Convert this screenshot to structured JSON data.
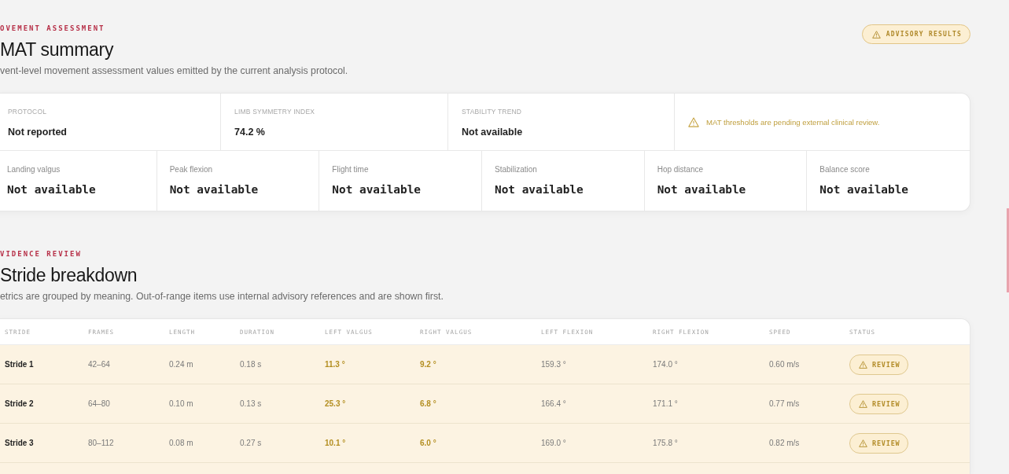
{
  "summary_section": {
    "eyebrow": "OVEMENT ASSESSMENT",
    "title": "MAT summary",
    "description": "vent-level movement assessment values emitted by the current analysis protocol.",
    "badge": {
      "label": "ADVISORY RESULTS",
      "kind": "advisory"
    },
    "overview": [
      {
        "label": "PROTOCOL",
        "value": "Not reported"
      },
      {
        "label": "LIMB SYMMETRY INDEX",
        "value": "74.2 %"
      },
      {
        "label": "STABILITY TREND",
        "value": "Not available"
      }
    ],
    "notice": "MAT thresholds are pending external clinical review.",
    "metrics": [
      {
        "label": "Landing valgus",
        "value": "Not available"
      },
      {
        "label": "Peak flexion",
        "value": "Not available"
      },
      {
        "label": "Flight time",
        "value": "Not available"
      },
      {
        "label": "Stabilization",
        "value": "Not available"
      },
      {
        "label": "Hop distance",
        "value": "Not available"
      },
      {
        "label": "Balance score",
        "value": "Not available"
      }
    ]
  },
  "evidence_section": {
    "eyebrow": "VIDENCE REVIEW",
    "title": "Stride breakdown",
    "description": "etrics are grouped by meaning. Out-of-range items use internal advisory references and are shown first.",
    "table": {
      "columns": [
        "STRIDE",
        "FRAMES",
        "LENGTH",
        "DURATION",
        "LEFT VALGUS",
        "RIGHT VALGUS",
        "LEFT FLEXION",
        "RIGHT FLEXION",
        "SPEED",
        "STATUS"
      ],
      "rows": [
        {
          "flagged": true,
          "cells": [
            {
              "text": "Stride 1",
              "kind": "label",
              "flagged": false
            },
            {
              "text": "42–64",
              "kind": "value",
              "flagged": false
            },
            {
              "text": "0.24 m",
              "kind": "value",
              "flagged": false
            },
            {
              "text": "0.18 s",
              "kind": "value",
              "flagged": false
            },
            {
              "text": "11.3 °",
              "kind": "value",
              "flagged": true
            },
            {
              "text": "9.2 °",
              "kind": "value",
              "flagged": true
            },
            {
              "text": "159.3 °",
              "kind": "value",
              "flagged": false
            },
            {
              "text": "174.0 °",
              "kind": "value",
              "flagged": false
            },
            {
              "text": "0.60 m/s",
              "kind": "value",
              "flagged": false
            }
          ],
          "status": {
            "label": "REVIEW",
            "kind": "review"
          }
        },
        {
          "flagged": true,
          "cells": [
            {
              "text": "Stride 2",
              "kind": "label",
              "flagged": false
            },
            {
              "text": "64–80",
              "kind": "value",
              "flagged": false
            },
            {
              "text": "0.10 m",
              "kind": "value",
              "flagged": false
            },
            {
              "text": "0.13 s",
              "kind": "value",
              "flagged": false
            },
            {
              "text": "25.3 °",
              "kind": "value",
              "flagged": true
            },
            {
              "text": "6.8 °",
              "kind": "value",
              "flagged": true
            },
            {
              "text": "166.4 °",
              "kind": "value",
              "flagged": false
            },
            {
              "text": "171.1 °",
              "kind": "value",
              "flagged": false
            },
            {
              "text": "0.77 m/s",
              "kind": "value",
              "flagged": false
            }
          ],
          "status": {
            "label": "REVIEW",
            "kind": "review"
          }
        },
        {
          "flagged": true,
          "cells": [
            {
              "text": "Stride 3",
              "kind": "label",
              "flagged": false
            },
            {
              "text": "80–112",
              "kind": "value",
              "flagged": false
            },
            {
              "text": "0.08 m",
              "kind": "value",
              "flagged": false
            },
            {
              "text": "0.27 s",
              "kind": "value",
              "flagged": false
            },
            {
              "text": "10.1 °",
              "kind": "value",
              "flagged": true
            },
            {
              "text": "6.0 °",
              "kind": "value",
              "flagged": true
            },
            {
              "text": "169.0 °",
              "kind": "value",
              "flagged": false
            },
            {
              "text": "175.8 °",
              "kind": "value",
              "flagged": false
            },
            {
              "text": "0.82 m/s",
              "kind": "value",
              "flagged": false
            }
          ],
          "status": {
            "label": "REVIEW",
            "kind": "review"
          }
        }
      ]
    }
  }
}
